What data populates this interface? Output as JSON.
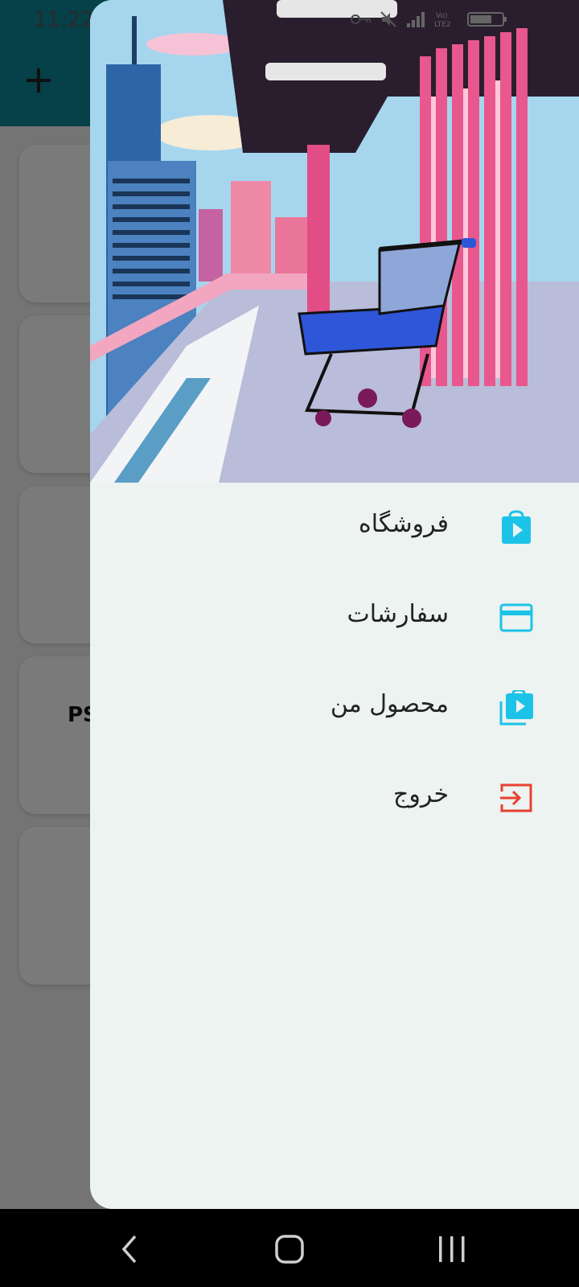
{
  "status_bar": {
    "time": "11:22",
    "right_icons": [
      "key-icon",
      "mute-icon",
      "signal-icon",
      "volte-lte2-icon",
      "battery-icon"
    ],
    "left_icons": [
      "gallery-icon",
      "carrier-icon",
      "warning-icon"
    ]
  },
  "background_app": {
    "appbar_color": "#0e8797",
    "add_icon": "plus-icon",
    "visible_card_text": "PS"
  },
  "drawer": {
    "header_image": "shopping-cart-city-illustration",
    "menu": [
      {
        "label": "فروشگاه",
        "icon": "store-bag-icon",
        "color": "#1cc3e8"
      },
      {
        "label": "سفارشات",
        "icon": "credit-card-icon",
        "color": "#1cc3e8"
      },
      {
        "label": "محصول من",
        "icon": "my-products-icon",
        "color": "#1cc3e8"
      },
      {
        "label": "خروج",
        "icon": "logout-icon",
        "color": "#e8402f"
      }
    ]
  },
  "nav_bar": {
    "buttons": [
      "back-icon",
      "home-icon",
      "recents-icon"
    ]
  }
}
